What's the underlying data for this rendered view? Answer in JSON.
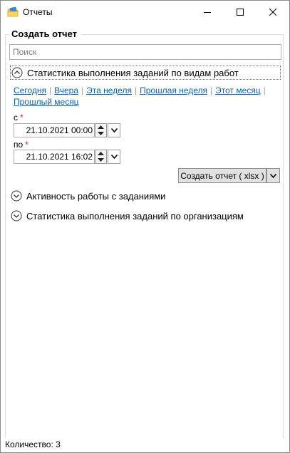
{
  "window": {
    "title": "Отчеты",
    "icon": "folder-report-icon"
  },
  "group": {
    "title": "Создать отчет"
  },
  "search": {
    "placeholder": "Поиск"
  },
  "sections": [
    {
      "label": "Статистика выполнения заданий по видам работ",
      "expanded": true
    },
    {
      "label": "Активность работы с заданиями",
      "expanded": false
    },
    {
      "label": "Статистика выполнения заданий по организациям",
      "expanded": false
    }
  ],
  "quick_links": [
    "Сегодня",
    "Вчера",
    "Эта неделя",
    "Прошлая неделя",
    "Этот месяц",
    "Прошлый месяц"
  ],
  "from": {
    "label": "с",
    "required_mark": "*",
    "value": "21.10.2021 00:00"
  },
  "to": {
    "label": "по",
    "required_mark": "*",
    "value": "21.10.2021 16:02"
  },
  "create_button": {
    "label": "Создать отчет ( xlsx )"
  },
  "status": {
    "count_text": "Количество: 3"
  },
  "colors": {
    "link": "#0563c1",
    "required": "#e02020",
    "button_bg": "#e1e1e1"
  }
}
